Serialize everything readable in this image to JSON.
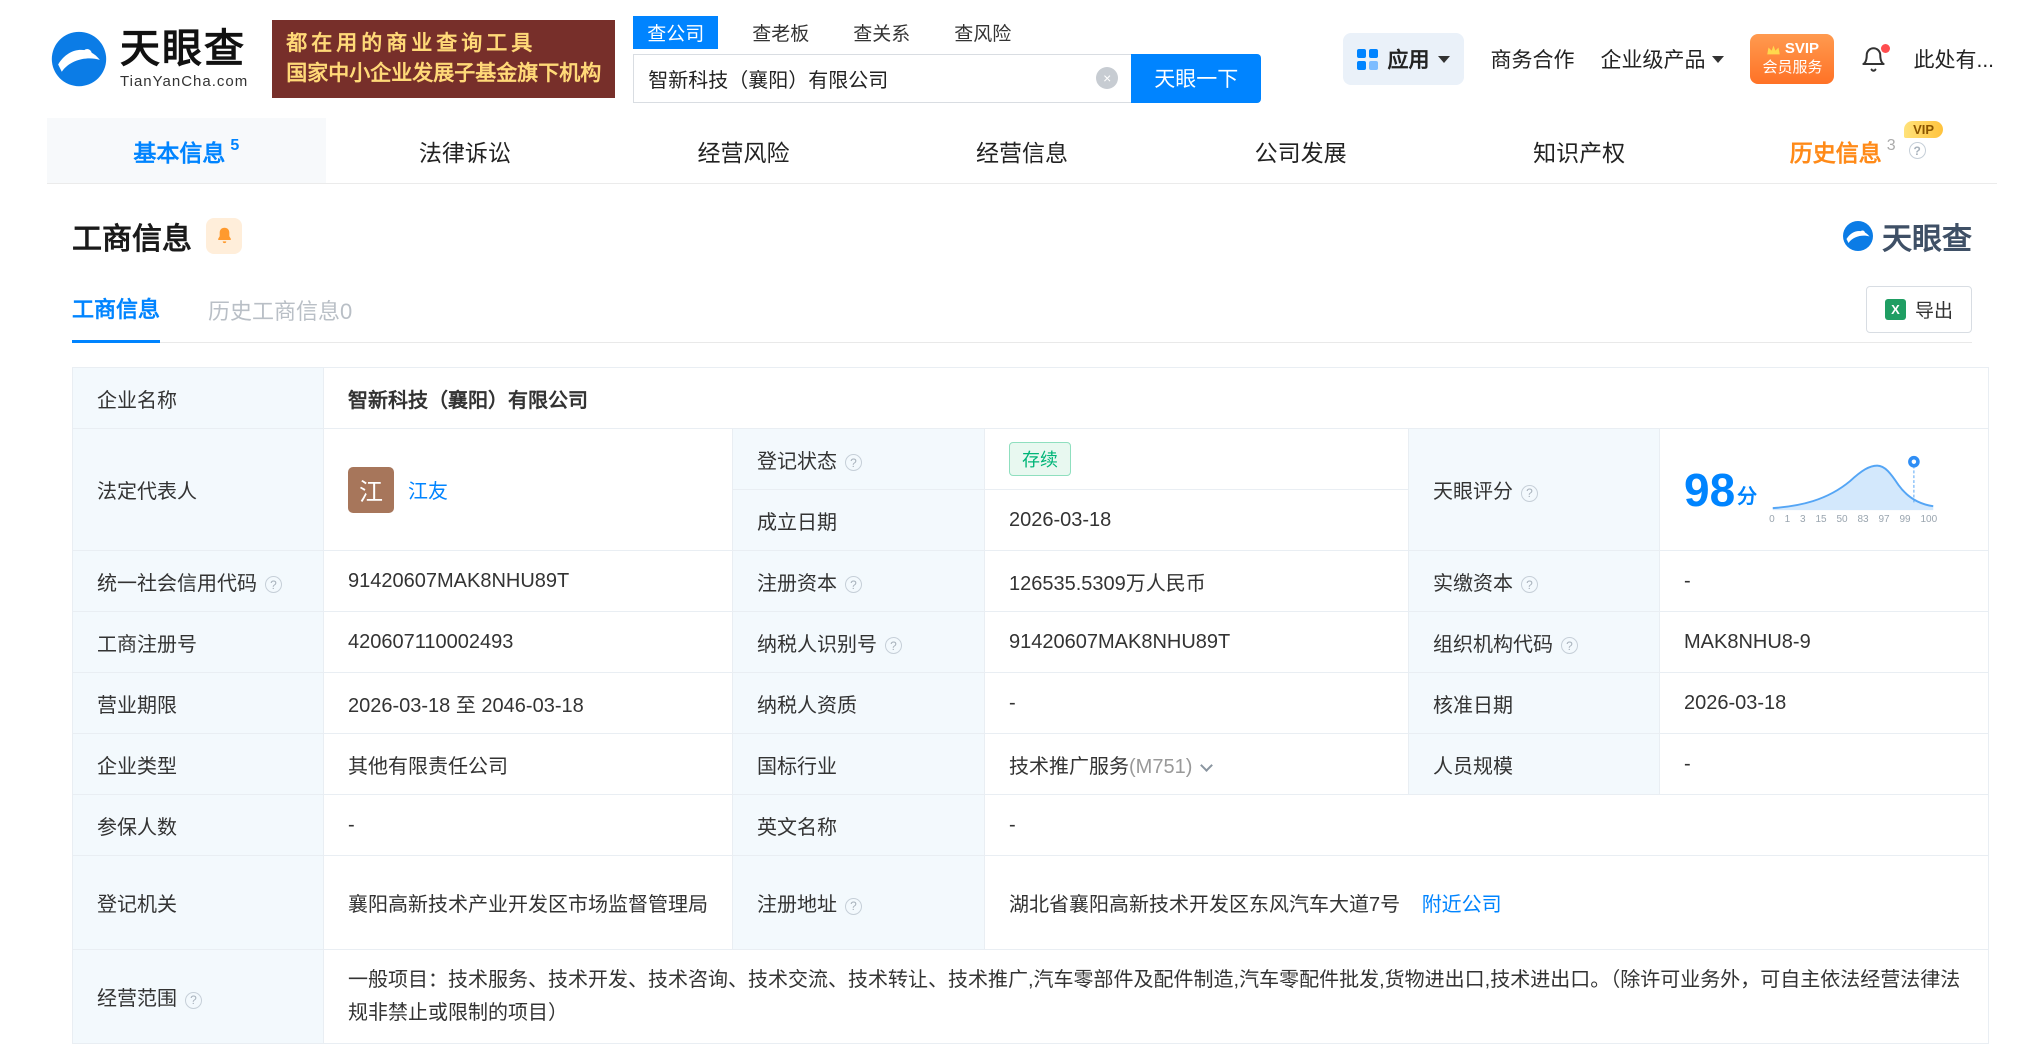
{
  "colors": {
    "brand_blue": "#0084ff",
    "status_green": "#00b578",
    "history_orange": "#ff8a18",
    "tagline_bg": "#772f2a",
    "tagline_gold": "#ffd978"
  },
  "icons": {
    "clear": "×",
    "help": "?",
    "excel": "X"
  },
  "header": {
    "logo": {
      "brand": "天眼查",
      "domain": "TianYanCha.com"
    },
    "tagline": {
      "line1": "都在用的商业查询工具",
      "line2": "国家中小企业发展子基金旗下机构"
    },
    "search": {
      "tabs": [
        {
          "label": "查公司",
          "active": true
        },
        {
          "label": "查老板",
          "active": false
        },
        {
          "label": "查关系",
          "active": false
        },
        {
          "label": "查风险",
          "active": false
        }
      ],
      "value": "智新科技（襄阳）有限公司",
      "button": "天眼一下"
    },
    "nav": {
      "apps": "应用",
      "cooperation": "商务合作",
      "enterprise": "企业级产品",
      "svip_line1": "SVIP",
      "svip_line2": "会员服务",
      "user": "此处有..."
    }
  },
  "tabs": [
    {
      "label": "基本信息",
      "count": "5"
    },
    {
      "label": "法律诉讼"
    },
    {
      "label": "经营风险"
    },
    {
      "label": "经营信息"
    },
    {
      "label": "公司发展"
    },
    {
      "label": "知识产权"
    },
    {
      "label": "历史信息",
      "count": "3",
      "vip": "VIP"
    }
  ],
  "section": {
    "title": "工商信息",
    "watermark": "天眼查",
    "subtabs": [
      {
        "label": "工商信息",
        "active": true
      },
      {
        "label": "历史工商信息0",
        "active": false
      }
    ],
    "export": "导出"
  },
  "company": {
    "name_label": "企业名称",
    "name": "智新科技（襄阳）有限公司",
    "legal_rep_label": "法定代表人",
    "legal_rep_avatar": "江",
    "legal_rep": "江友",
    "reg_status_label": "登记状态",
    "reg_status": "存续",
    "score_label": "天眼评分",
    "score": "98",
    "score_unit": "分",
    "score_ticks": [
      "0",
      "1",
      "3",
      "15",
      "50",
      "83",
      "97",
      "99",
      "100"
    ],
    "est_date_label": "成立日期",
    "est_date": "2026-03-18",
    "credit_code_label": "统一社会信用代码",
    "credit_code": "91420607MAK8NHU89T",
    "reg_capital_label": "注册资本",
    "reg_capital": "126535.5309万人民币",
    "paid_capital_label": "实缴资本",
    "paid_capital": "-",
    "reg_number_label": "工商注册号",
    "reg_number": "420607110002493",
    "taxpayer_id_label": "纳税人识别号",
    "taxpayer_id": "91420607MAK8NHU89T",
    "org_code_label": "组织机构代码",
    "org_code": "MAK8NHU8-9",
    "business_term_label": "营业期限",
    "business_term": "2026-03-18 至 2046-03-18",
    "taxpayer_qual_label": "纳税人资质",
    "taxpayer_qual": "-",
    "approval_date_label": "核准日期",
    "approval_date": "2026-03-18",
    "company_type_label": "企业类型",
    "company_type": "其他有限责任公司",
    "industry_label": "国标行业",
    "industry": "技术推广服务",
    "industry_code": "(M751)",
    "staff_size_label": "人员规模",
    "staff_size": "-",
    "insured_label": "参保人数",
    "insured": "-",
    "english_name_label": "英文名称",
    "english_name": "-",
    "reg_authority_label": "登记机关",
    "reg_authority": "襄阳高新技术产业开发区市场监督管理局",
    "address_label": "注册地址",
    "address": "湖北省襄阳高新技术开发区东风汽车大道7号",
    "nearby_link": "附近公司",
    "scope_label": "经营范围",
    "scope": "一般项目：技术服务、技术开发、技术咨询、技术交流、技术转让、技术推广,汽车零部件及配件制造,汽车零配件批发,货物进出口,技术进出口。（除许可业务外，可自主依法经营法律法规非禁止或限制的项目）"
  }
}
